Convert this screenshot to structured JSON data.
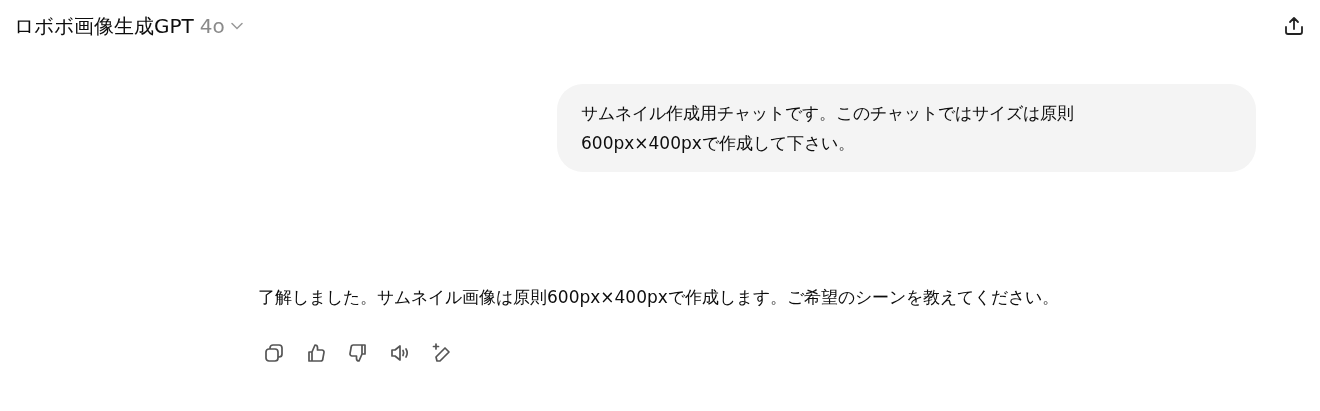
{
  "header": {
    "title": "ロボボ画像生成GPT",
    "model": "4o"
  },
  "messages": [
    {
      "kind": "user",
      "lines": [
        "サムネイル作成用チャットです。このチャットではサイズは原則",
        "600px×400pxで作成して下さい。"
      ]
    },
    {
      "kind": "assistant",
      "lines": [
        "了解しました。サムネイル画像は原則600px×400pxで作成します。ご希望のシーンを教えてください。"
      ]
    }
  ]
}
